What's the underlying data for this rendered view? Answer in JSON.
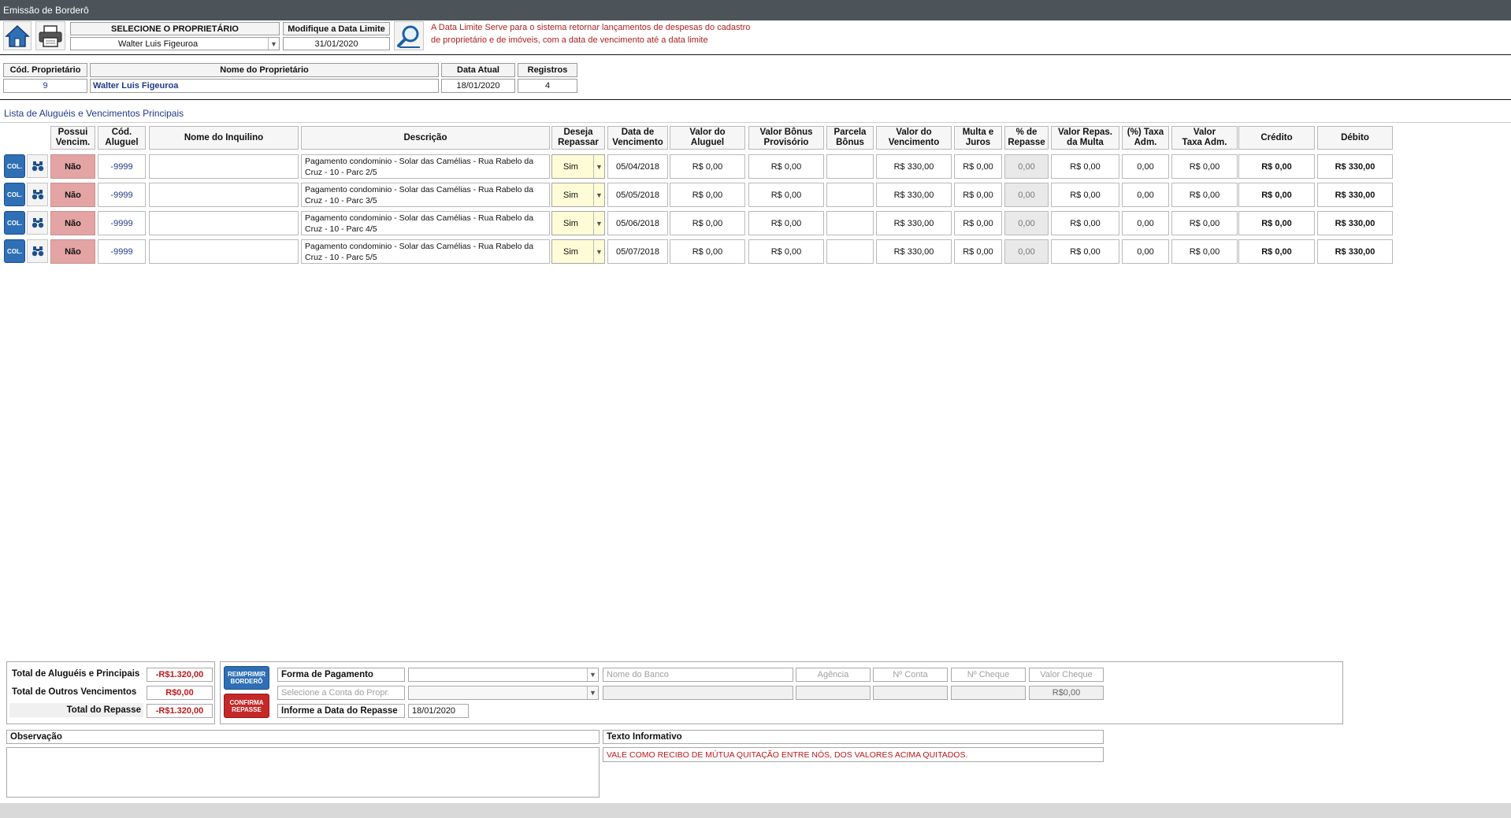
{
  "window": {
    "title": "Emissão de Borderô"
  },
  "toolbar": {
    "owner_select_label": "SELECIONE O PROPRIETÁRIO",
    "owner_select_value": "Walter Luis Figeuroa",
    "date_limit_label": "Modifique a Data Limite",
    "date_limit_value": "31/01/2020",
    "note_line1": "A Data Limite Serve para o sistema retornar lançamentos de despesas do cadastro",
    "note_line2": "de proprietário e de imóveis, com a data de vencimento até a data limite"
  },
  "summary": {
    "code_label": "Cód. Proprietário",
    "code_value": "9",
    "name_label": "Nome do Proprietário",
    "name_value": "Walter Luis Figeuroa",
    "date_label": "Data Atual",
    "date_value": "18/01/2020",
    "records_label": "Registros",
    "records_value": "4"
  },
  "list": {
    "title": "Lista de Aluguéis e Vencimentos Principais",
    "columns": [
      "Possui\nVencim.",
      "Cód.\nAluguel",
      "Nome do Inquilino",
      "Descrição",
      "Deseja\nRepassar",
      "Data de\nVencimento",
      "Valor do\nAluguel",
      "Valor Bônus\nProvisório",
      "Parcela\nBônus",
      "Valor do\nVencimento",
      "Multa e\nJuros",
      "% de\nRepasse",
      "Valor Repas.\nda Multa",
      "(%) Taxa\nAdm.",
      "Valor\nTaxa Adm.",
      "Crédito",
      "Débito"
    ],
    "col_button_label": "COL.",
    "rows": [
      {
        "possui": "Não",
        "codigo": "-9999",
        "inquilino": "",
        "descricao": "Pagamento condominio -  Solar das Camélias -  Rua Rabelo da Cruz - 10 - Parc 2/5",
        "repassar": "Sim",
        "data": "05/04/2018",
        "aluguel": "R$ 0,00",
        "bonus": "R$ 0,00",
        "parcela": "",
        "vencimento": "R$ 330,00",
        "multa": "R$ 0,00",
        "repasse": "0,00",
        "repas_multa": "R$ 0,00",
        "taxa_pct": "0,00",
        "taxa_valor": "R$ 0,00",
        "credito": "R$ 0,00",
        "debito": "R$ 330,00"
      },
      {
        "possui": "Não",
        "codigo": "-9999",
        "inquilino": "",
        "descricao": "Pagamento condominio -  Solar das Camélias -  Rua Rabelo da Cruz - 10 - Parc 3/5",
        "repassar": "Sim",
        "data": "05/05/2018",
        "aluguel": "R$ 0,00",
        "bonus": "R$ 0,00",
        "parcela": "",
        "vencimento": "R$ 330,00",
        "multa": "R$ 0,00",
        "repasse": "0,00",
        "repas_multa": "R$ 0,00",
        "taxa_pct": "0,00",
        "taxa_valor": "R$ 0,00",
        "credito": "R$ 0,00",
        "debito": "R$ 330,00"
      },
      {
        "possui": "Não",
        "codigo": "-9999",
        "inquilino": "",
        "descricao": "Pagamento condominio -  Solar das Camélias -  Rua Rabelo da Cruz - 10 - Parc 4/5",
        "repassar": "Sim",
        "data": "05/06/2018",
        "aluguel": "R$ 0,00",
        "bonus": "R$ 0,00",
        "parcela": "",
        "vencimento": "R$ 330,00",
        "multa": "R$ 0,00",
        "repasse": "0,00",
        "repas_multa": "R$ 0,00",
        "taxa_pct": "0,00",
        "taxa_valor": "R$ 0,00",
        "credito": "R$ 0,00",
        "debito": "R$ 330,00"
      },
      {
        "possui": "Não",
        "codigo": "-9999",
        "inquilino": "",
        "descricao": "Pagamento condominio -  Solar das Camélias -  Rua Rabelo da Cruz - 10 - Parc 5/5",
        "repassar": "Sim",
        "data": "05/07/2018",
        "aluguel": "R$ 0,00",
        "bonus": "R$ 0,00",
        "parcela": "",
        "vencimento": "R$ 330,00",
        "multa": "R$ 0,00",
        "repasse": "0,00",
        "repas_multa": "R$ 0,00",
        "taxa_pct": "0,00",
        "taxa_valor": "R$ 0,00",
        "credito": "R$ 0,00",
        "debito": "R$ 330,00"
      }
    ]
  },
  "totals": {
    "alugueis_label": "Total de Aluguéis e Principais",
    "alugueis_value": "-R$1.320,00",
    "outros_label": "Total de Outros Vencimentos",
    "outros_value": "R$0,00",
    "repasse_label": "Total do Repasse",
    "repasse_value": "-R$1.320,00"
  },
  "payment": {
    "reprint_label": "REIMPRIMIR\nBORDERÔ",
    "confirm_label": "CONFIRMA\nREPASSE",
    "forma_label": "Forma de Pagamento",
    "forma_value": "",
    "conta_placeholder": "Selecione a Conta do Propr.",
    "conta_value": "",
    "data_label": "Informe a Data do Repasse",
    "data_value": "18/01/2020",
    "banco_placeholder": "Nome do Banco",
    "agencia_placeholder": "Agência",
    "conta_num_placeholder": "Nº Conta",
    "cheque_placeholder": "Nº Cheque",
    "valor_cheque_placeholder": "Valor Cheque",
    "valor_cheque_value": "R$0,00"
  },
  "footer": {
    "obs_label": "Observação",
    "obs_value": "",
    "info_label": "Texto Informativo",
    "info_value": "VALE COMO RECIBO DE MÚTUA QUITAÇÃO ENTRE NÓS, DOS VALORES ACIMA QUITADOS."
  },
  "icons": {
    "home": "home-icon",
    "print": "printer-icon",
    "search": "magnifier-icon",
    "view": "binoculars-icon",
    "dropdown": "chevron-down-icon"
  },
  "colors": {
    "titlebar": "#4c5459",
    "no_badge": "#e4a4a4",
    "yes_select": "#fefcd6",
    "col_button": "#2e6fb5",
    "reprint_button": "#2e6fb5",
    "confirm_button": "#c62828",
    "negative_text": "#c01818",
    "note_text": "#b02020"
  }
}
